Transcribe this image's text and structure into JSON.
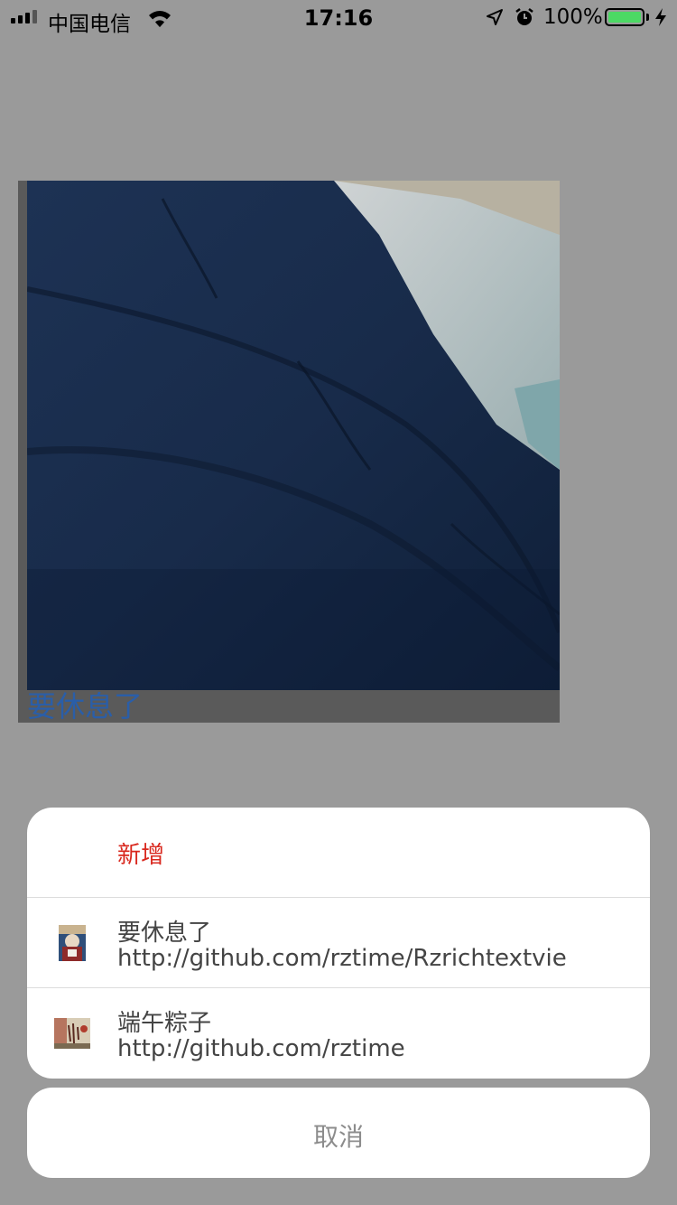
{
  "status_bar": {
    "carrier": "中国电信",
    "time": "17:16",
    "battery_percent": "100%"
  },
  "preview": {
    "caption": "要休息了"
  },
  "action_sheet": {
    "add_label": "新增",
    "items": [
      {
        "title": "要休息了",
        "url": "http://github.com/rztime/Rzrichtextvie"
      },
      {
        "title": "端午粽子",
        "url": "http://github.com/rztime"
      }
    ],
    "cancel_label": "取消"
  },
  "colors": {
    "overlay": "#9a9a9a",
    "accent_red": "#d9281e",
    "caption_blue": "#2a5ea8",
    "battery_green": "#4cd964"
  }
}
